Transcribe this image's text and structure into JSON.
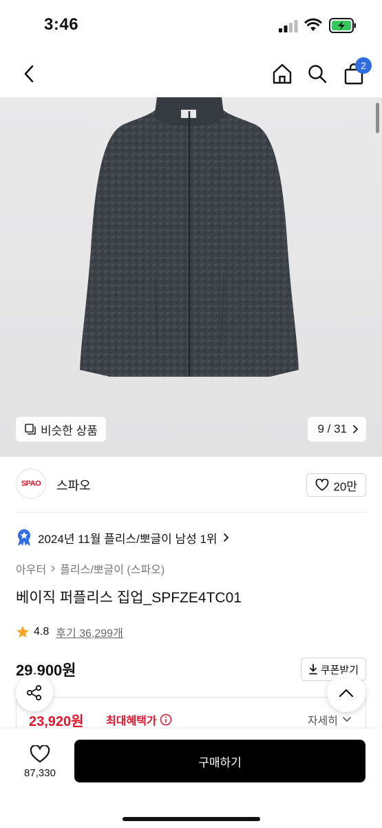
{
  "status_bar": {
    "time": "3:46"
  },
  "nav": {
    "cart_count": "2"
  },
  "gallery": {
    "similar_label": "비슷한 상품",
    "page_indicator": "9 / 31"
  },
  "brand": {
    "logo_text": "SPAO",
    "name": "스파오",
    "like_count": "20만"
  },
  "ranking": {
    "text": "2024년 11월 플리스/뽀글이 남성 1위"
  },
  "breadcrumb": {
    "category": "아우터",
    "subcategory": "플리스/뽀글이 (스파오)"
  },
  "product": {
    "title": "베이직 퍼플리스 집업_SPFZE4TC01",
    "rating": "4.8",
    "reviews": "후기 36,299개",
    "price": "29,900원",
    "coupon_label": "쿠폰받기"
  },
  "benefit": {
    "price": "23,920원",
    "label": "최대혜택가",
    "detail": "자세히"
  },
  "bottom_bar": {
    "wish_count": "87,330",
    "buy_label": "구매하기"
  },
  "colors": {
    "accent_red": "#e5142b",
    "badge_blue": "#2f6de1",
    "star_gold": "#f5a623",
    "jacket": "#3d4148"
  }
}
